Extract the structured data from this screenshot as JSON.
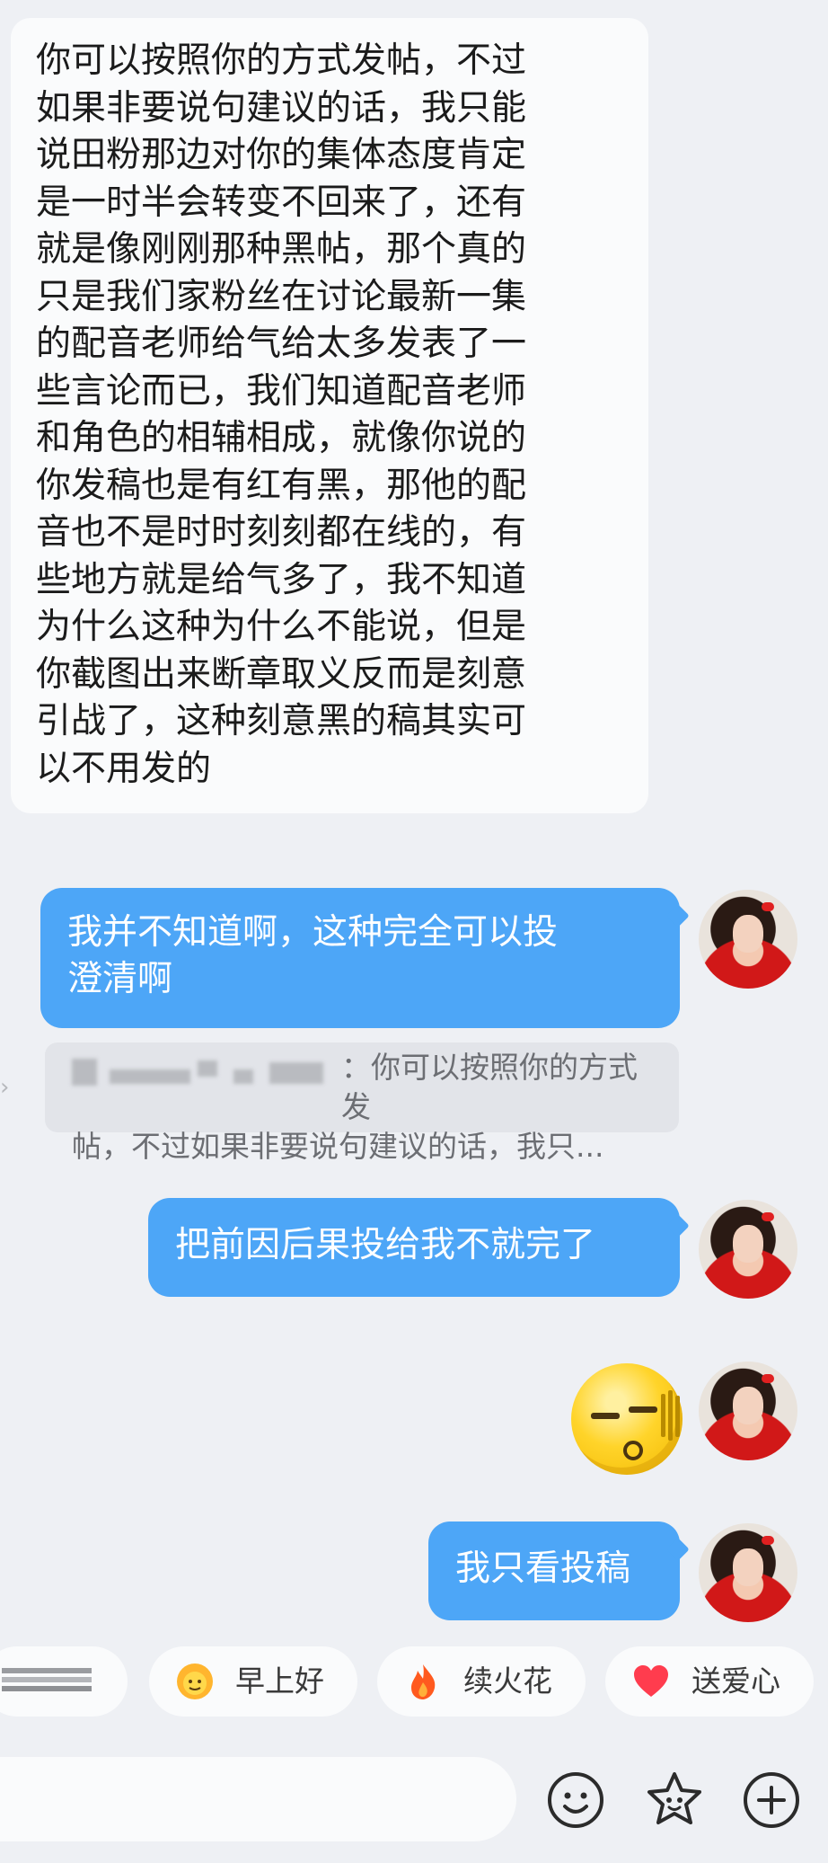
{
  "messages": {
    "incoming_1": {
      "lines": [
        "你可以按照你的方式发帖，不过",
        "如果非要说句建议的话，我只能",
        "说田粉那边对你的集体态度肯定",
        "是一时半会转变不回来了，还有",
        "就是像刚刚那种黑帖，那个真的",
        "只是我们家粉丝在讨论最新一集",
        "的配音老师给气给太多发表了一",
        "些言论而已，我们知道配音老师",
        "和角色的相辅相成，就像你说的",
        "你发稿也是有红有黑，那他的配",
        "音也不是时时刻刻都在线的，有",
        "些地方就是给气多了，我不知道",
        "为什么这种为什么不能说，但是",
        "你截图出来断章取义反而是刻意",
        "引战了，这种刻意黑的稿其实可",
        "以不用发的"
      ]
    },
    "outgoing_1": {
      "lines": [
        "我并不知道啊，这种完全可以投",
        "澄清啊"
      ]
    },
    "quote_1": {
      "line1": "：你可以按照你的方式发",
      "line2": "帖，不过如果非要说句建议的话，我只..."
    },
    "outgoing_2": {
      "text": "把前因后果投给我不就完了"
    },
    "outgoing_3": {
      "emoji": "speechless-emoji"
    },
    "outgoing_4": {
      "text": "我只看投稿"
    }
  },
  "quick_replies": [
    {
      "label": "早上好",
      "icon": "sun-face-icon"
    },
    {
      "label": "续火花",
      "icon": "fire-icon"
    },
    {
      "label": "送爱心",
      "icon": "heart-icon"
    }
  ],
  "colors": {
    "background": "#eef0f4",
    "incoming_bubble": "#fafbfc",
    "outgoing_bubble": "#4da6f7"
  },
  "input_icons": [
    "emoji-face-icon",
    "star-face-icon",
    "plus-icon"
  ]
}
